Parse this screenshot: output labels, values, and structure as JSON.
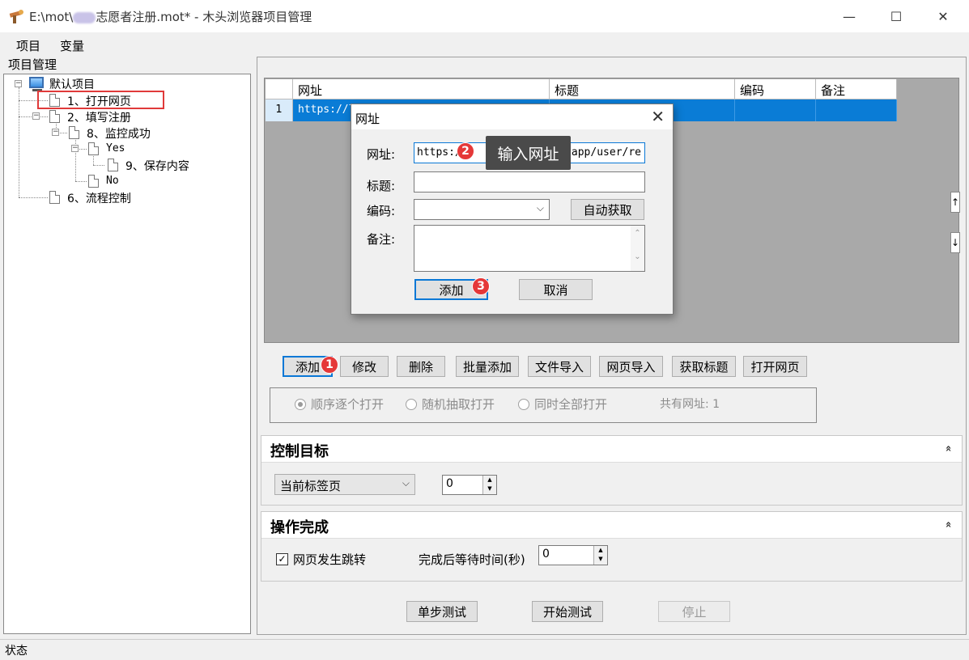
{
  "window": {
    "title_prefix": "E:\\mot\\",
    "title_suffix": "志愿者注册.mot* - 木头浏览器项目管理",
    "minimize": "—",
    "maximize": "☐",
    "close": "✕"
  },
  "menu": [
    "项目",
    "变量"
  ],
  "tree": {
    "header": "项目管理",
    "root": "默认项目",
    "items": [
      {
        "label": "1、打开网页"
      },
      {
        "label": "2、填写注册"
      },
      {
        "label": "8、监控成功"
      },
      {
        "label": "Yes"
      },
      {
        "label": "9、保存内容"
      },
      {
        "label": "No"
      },
      {
        "label": "6、流程控制"
      }
    ],
    "expander_minus": "−"
  },
  "grid": {
    "columns": [
      "网址",
      "标题",
      "编码",
      "备注"
    ],
    "rows": [
      {
        "num": "1",
        "url": "https://l",
        "title": "",
        "encoding": "",
        "note": ""
      }
    ],
    "scroll_up": "↑",
    "scroll_down": "↓"
  },
  "toolbar": {
    "buttons": [
      "添加",
      "修改",
      "删除",
      "批量添加",
      "文件导入",
      "网页导入",
      "获取标题",
      "打开网页"
    ]
  },
  "open_mode": {
    "options": [
      "顺序逐个打开",
      "随机抽取打开",
      "同时全部打开"
    ],
    "selected": 0,
    "url_count": "共有网址: 1"
  },
  "control_target": {
    "title": "控制目标",
    "collapse": "»",
    "tab_select": "当前标签页",
    "tab_index": "0"
  },
  "operation_done": {
    "title": "操作完成",
    "collapse": "»",
    "page_jump_label": "网页发生跳转",
    "page_jump_checked": true,
    "wait_label": "完成后等待时间(秒)",
    "wait_value": "0"
  },
  "test_buttons": {
    "step": "单步测试",
    "start": "开始测试",
    "stop": "停止"
  },
  "status": {
    "label": "状态"
  },
  "dialog": {
    "title": "网址",
    "close": "✕",
    "url_label": "网址:",
    "url_value": "https://",
    "url_value_tail": "om/app/user/re",
    "title_label": "标题:",
    "title_value": "",
    "encoding_label": "编码:",
    "encoding_value": "",
    "auto_fetch": "自动获取",
    "note_label": "备注:",
    "note_value": "",
    "add": "添加",
    "cancel": "取消"
  },
  "annotations": {
    "badge1": "1",
    "badge2": "2",
    "badge3": "3",
    "tooltip": "输入网址",
    "highlight_color": "#e03a3a",
    "badge_color": "#e53838"
  },
  "colors": {
    "selection": "#0a7cd6",
    "grid_background": "#a9a9a9",
    "focus_border": "#0a78d6"
  }
}
